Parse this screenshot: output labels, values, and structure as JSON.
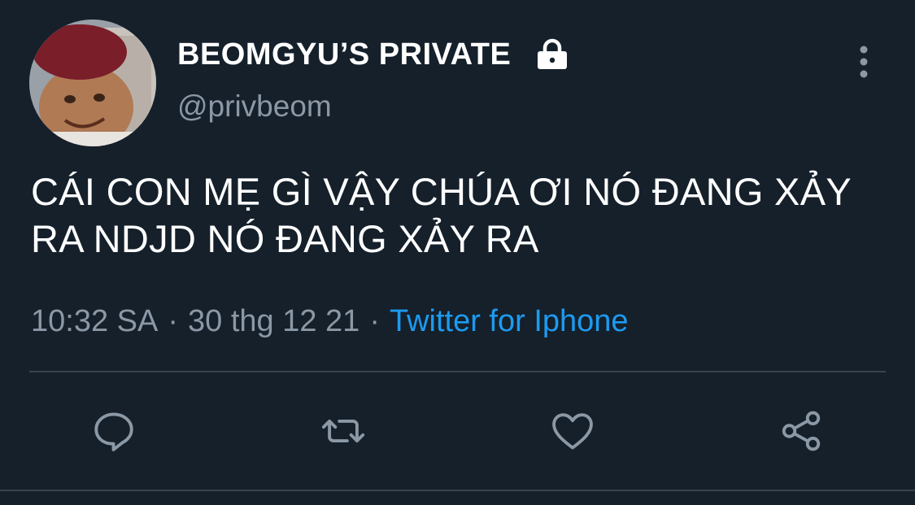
{
  "author": {
    "display_name": "BEOMGYU’S PRIVATE",
    "handle": "@privbeom",
    "protected": true
  },
  "tweet": {
    "text": "CÁI CON MẸ GÌ VẬY CHÚA ƠI NÓ ĐANG XẢY RA NDJD NÓ ĐANG XẢY RA",
    "time": "10:32 SA",
    "separator": "·",
    "date": "30 thg 12 21",
    "source": "Twitter for Iphone"
  },
  "icons": {
    "lock": "lock-icon",
    "more": "more-vertical-icon",
    "reply": "reply-icon",
    "retweet": "retweet-icon",
    "like": "heart-icon",
    "share": "share-icon"
  },
  "colors": {
    "background": "#15202b",
    "secondary_text": "#8b98a5",
    "link": "#1d9bf0",
    "divider": "#38444d",
    "icon": "#8b98a5"
  }
}
